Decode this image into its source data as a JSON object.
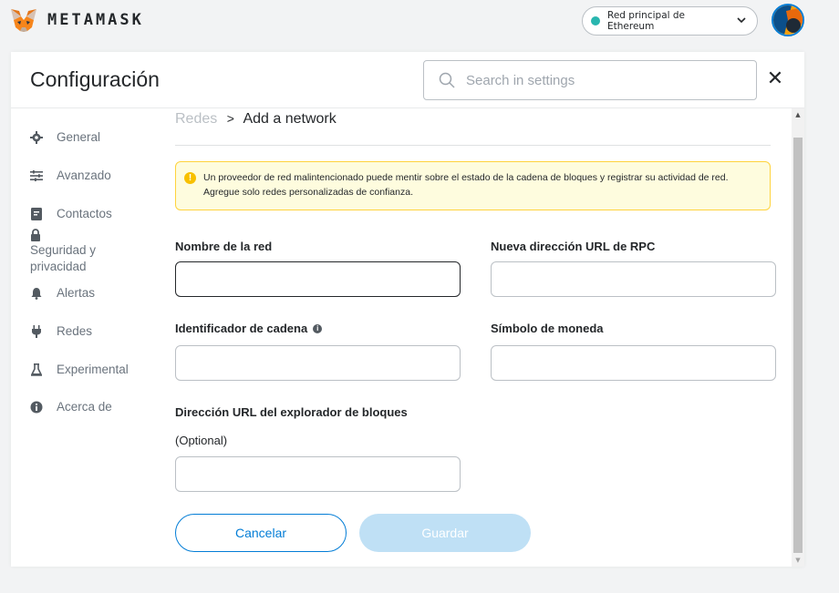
{
  "brand": {
    "name": "METAMASK"
  },
  "network": {
    "label": "Red principal de Ethereum",
    "dot_color": "#29b6af"
  },
  "settings": {
    "title": "Configuración",
    "search_placeholder": "Search in settings"
  },
  "sidebar": {
    "items": [
      {
        "label": "General",
        "icon": "gear-icon"
      },
      {
        "label": "Avanzado",
        "icon": "sliders-icon"
      },
      {
        "label": "Contactos",
        "icon": "contacts-book-icon"
      },
      {
        "label": "Seguridad y privacidad",
        "icon": "lock-icon"
      },
      {
        "label": "Alertas",
        "icon": "bell-icon"
      },
      {
        "label": "Redes",
        "icon": "plug-icon"
      },
      {
        "label": "Experimental",
        "icon": "flask-icon"
      },
      {
        "label": "Acerca de",
        "icon": "info-icon"
      }
    ]
  },
  "breadcrumb": {
    "parent": "Redes",
    "separator": ">",
    "current": "Add a network"
  },
  "warning": {
    "text": "Un proveedor de red malintencionado puede mentir sobre el estado de la cadena de bloques y registrar su actividad de red. Agregue solo redes personalizadas de confianza."
  },
  "form": {
    "network_name_label": "Nombre de la red",
    "network_name_value": "",
    "rpc_url_label": "Nueva dirección URL de RPC",
    "rpc_url_value": "",
    "chain_id_label": "Identificador de cadena",
    "chain_id_value": "",
    "currency_symbol_label": "Símbolo de moneda",
    "currency_symbol_value": "",
    "explorer_url_label": "Dirección URL del explorador de bloques",
    "explorer_optional": "(Optional)",
    "explorer_url_value": ""
  },
  "buttons": {
    "cancel": "Cancelar",
    "save": "Guardar"
  },
  "colors": {
    "accent": "#037dd6",
    "warning_bg": "#fefcde",
    "warning_border": "#ffd33d"
  }
}
